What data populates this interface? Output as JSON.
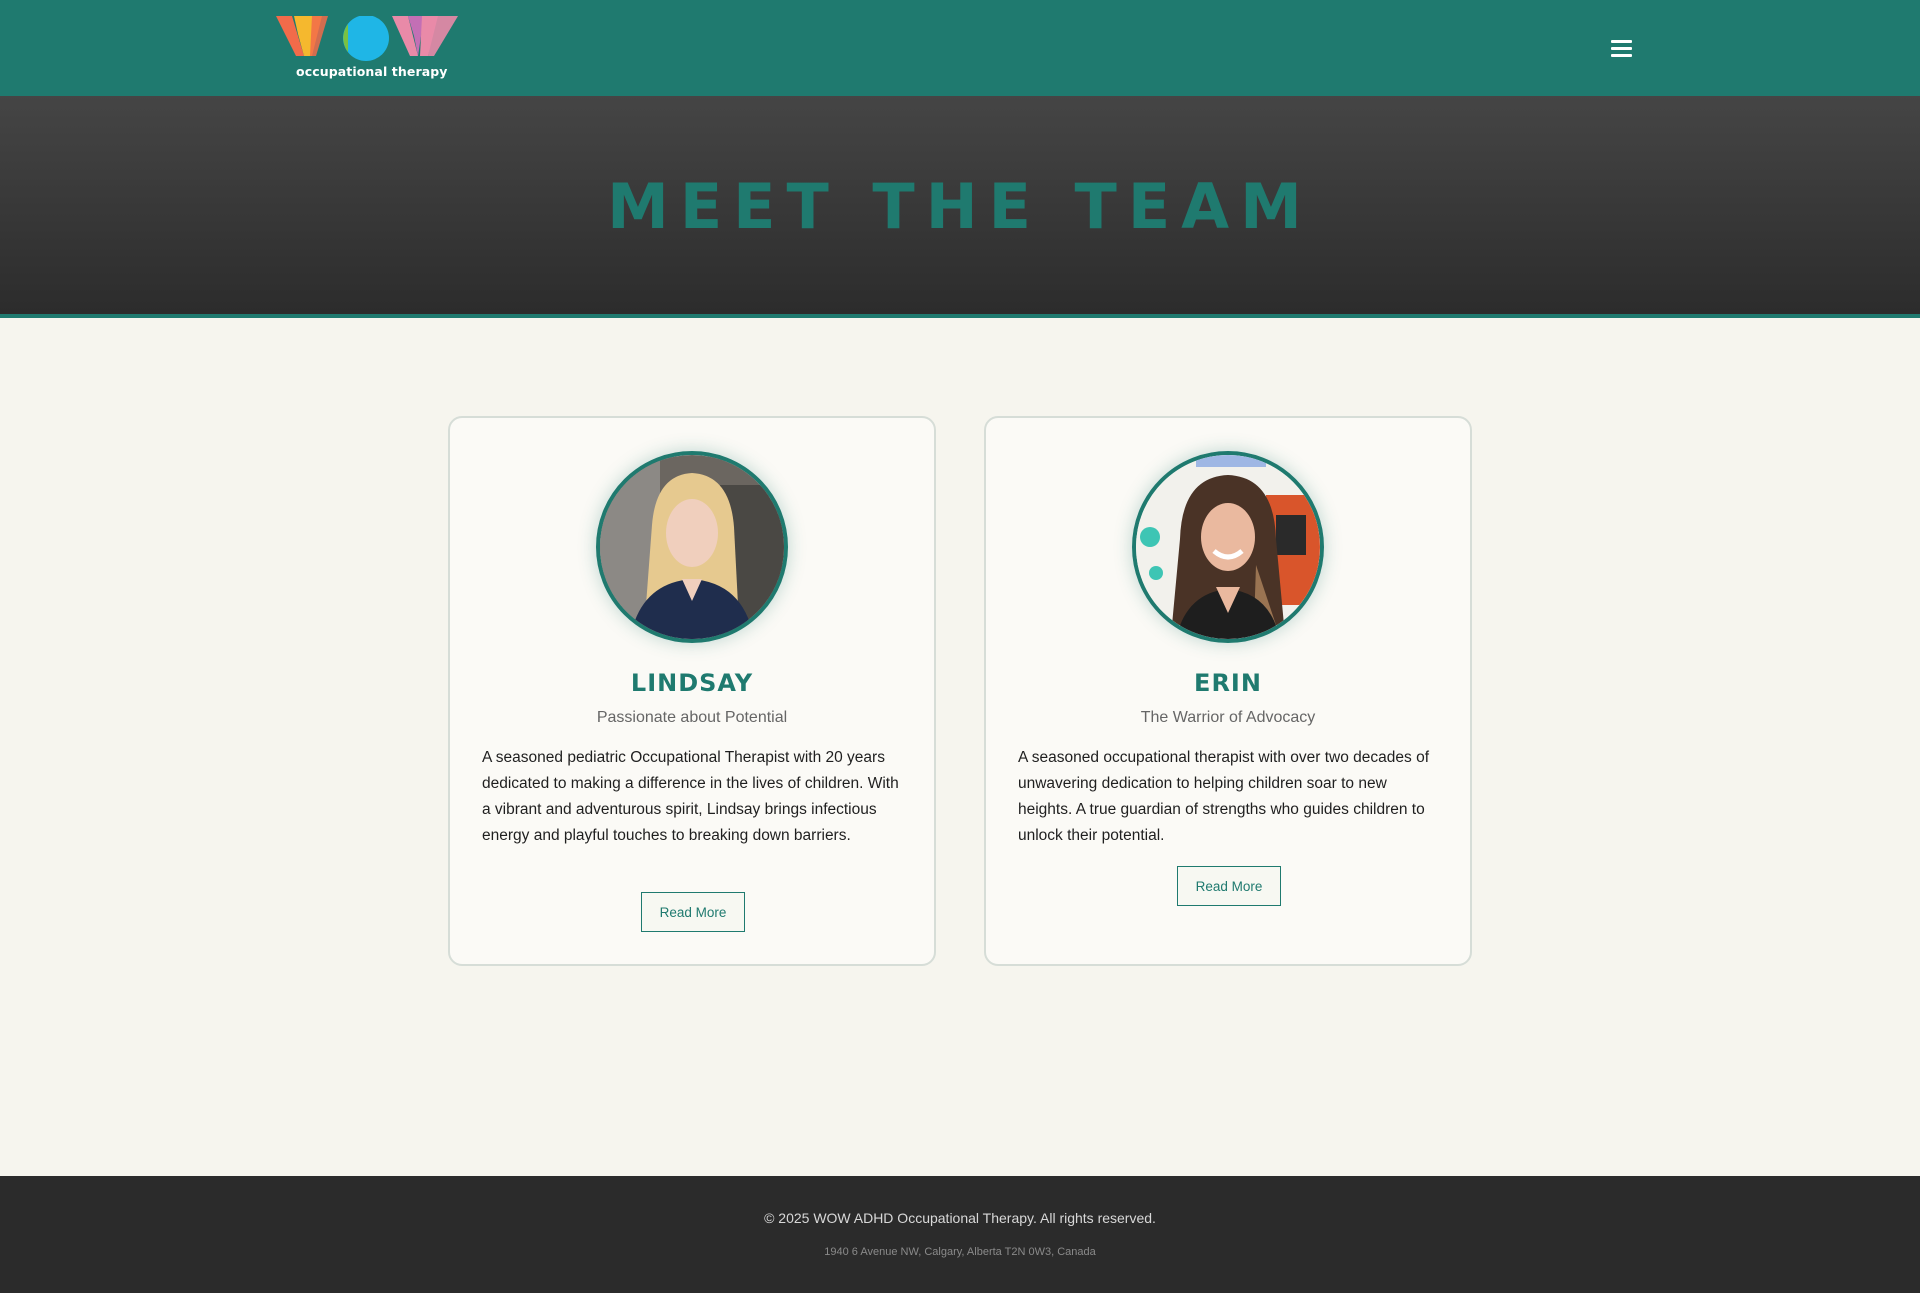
{
  "brand": {
    "logo_text": "WOW",
    "logo_subtitle": "occupational therapy"
  },
  "header": {
    "menu_icon": "hamburger-menu-icon"
  },
  "hero": {
    "title": "MEET THE TEAM"
  },
  "team": [
    {
      "name": "LINDSAY",
      "tagline": "Passionate about Potential",
      "bio": "A seasoned pediatric Occupational Therapist with 20 years dedicated to making a difference in the lives of children. With a vibrant and adventurous spirit, Lindsay brings infectious energy and playful touches to breaking down barriers.",
      "button_label": "Read More"
    },
    {
      "name": "ERIN",
      "tagline": "The Warrior of Advocacy",
      "bio": "A seasoned occupational therapist with over two decades of unwavering dedication to helping children soar to new heights. A true guardian of strengths who guides children to unlock their potential.",
      "button_label": "Read More"
    }
  ],
  "footer": {
    "copyright": "© 2025 WOW ADHD Occupational Therapy. All rights reserved.",
    "address": "1940 6 Avenue NW, Calgary, Alberta T2N 0W3, Canada"
  },
  "colors": {
    "brand_teal": "#1f7a6f",
    "hero_dark": "#2c2c2c",
    "page_bg": "#f6f5ee",
    "footer_bg": "#2b2b2b",
    "logo_orange": "#f26b4a",
    "logo_yellow": "#f5b82e",
    "logo_blue": "#1fb6e6",
    "logo_pink": "#e98aa8"
  }
}
